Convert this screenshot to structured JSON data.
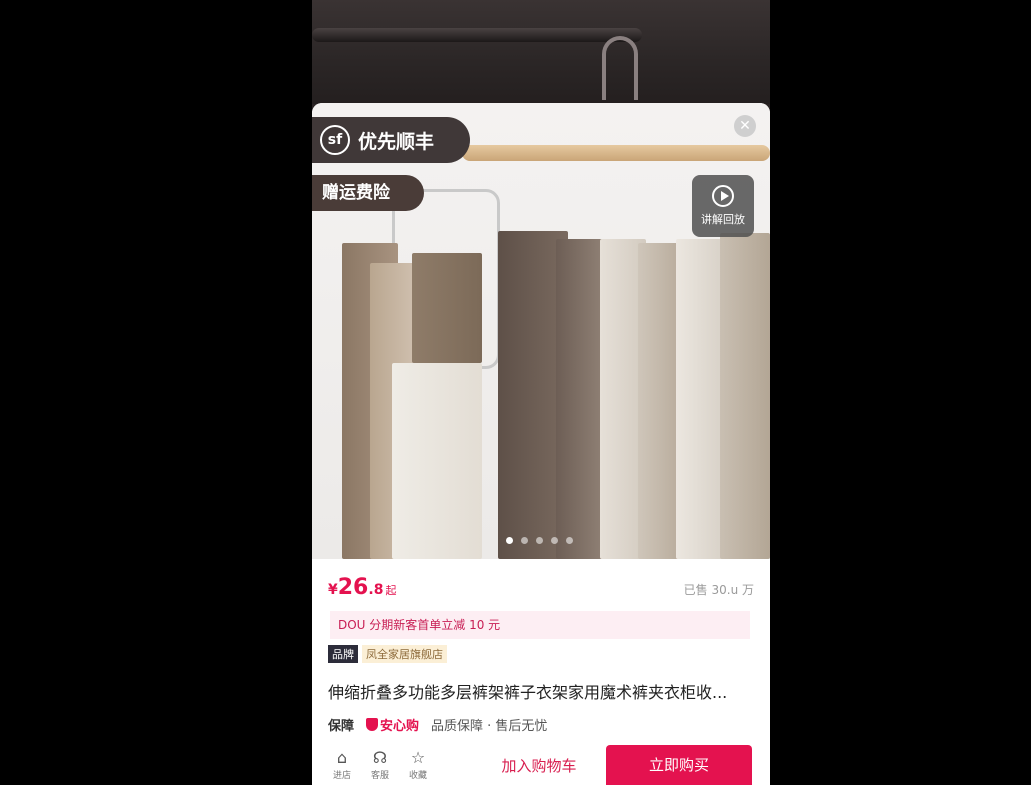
{
  "badges": {
    "sf_logo": "sf",
    "sf_text": "优先顺丰",
    "insurance": "赠运费险",
    "replay": "讲解回放"
  },
  "carousel": {
    "count": 5,
    "active": 0
  },
  "price": {
    "symbol": "¥",
    "integer": "26",
    "decimal": ".8",
    "suffix": "起"
  },
  "sold": "已售 30.u 万",
  "promo": "DOU 分期新客首单立减 10 元",
  "brand": {
    "tag": "品牌",
    "store": "凤全家居旗舰店"
  },
  "title": "伸缩折叠多功能多层裤架裤子衣架家用魔术裤夹衣柜收...",
  "guarantee": {
    "label": "保障",
    "logo": "安心购",
    "text": "品质保障 · 售后无忧"
  },
  "nav": [
    {
      "icon": "store-icon",
      "label": "进店"
    },
    {
      "icon": "customer-service-icon",
      "label": "客服"
    },
    {
      "icon": "star-icon",
      "label": "收藏"
    }
  ],
  "actions": {
    "cart": "加入购物车",
    "buy": "立即购买"
  },
  "colors": {
    "accent": "#e4124f",
    "badge_bg": "#403838"
  }
}
